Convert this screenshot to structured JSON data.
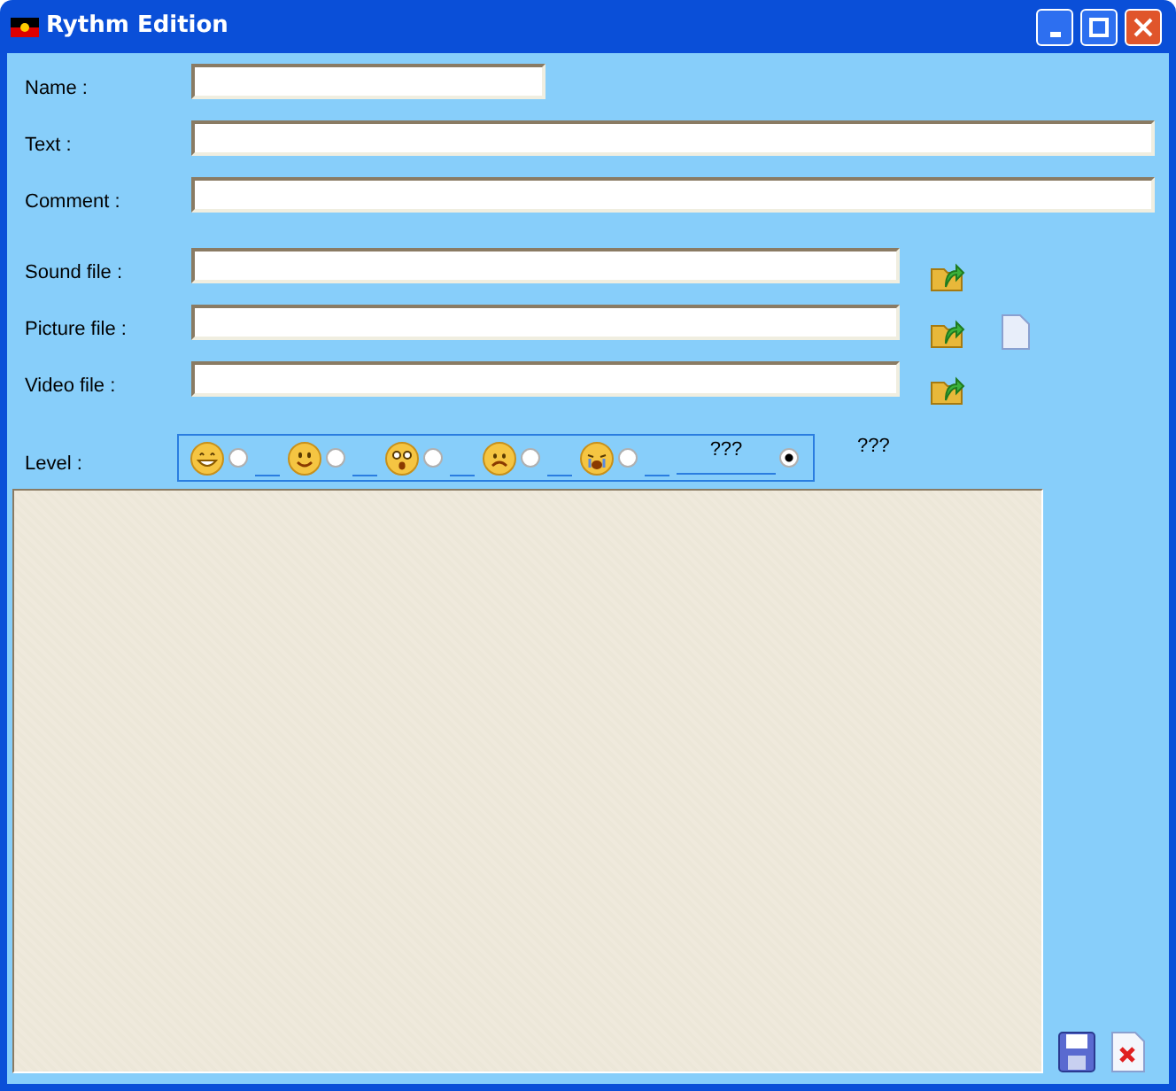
{
  "window": {
    "title": "Rythm Edition"
  },
  "fields": [
    {
      "label": "Name :",
      "full_width": false
    },
    {
      "label": "Text :",
      "full_width": true
    },
    {
      "label": "Comment :",
      "full_width": true
    }
  ],
  "files": [
    {
      "label": "Sound file :",
      "preview": false
    },
    {
      "label": "Picture file :",
      "preview": true
    },
    {
      "label": "Video file :",
      "preview": false
    }
  ],
  "level": {
    "label": "Level :",
    "options": [
      {
        "kind": "laughing",
        "selected": false
      },
      {
        "kind": "smiling",
        "selected": false
      },
      {
        "kind": "surprised",
        "selected": false
      },
      {
        "kind": "sad",
        "selected": false
      },
      {
        "kind": "crying",
        "selected": false
      },
      {
        "kind": "text",
        "label": "???",
        "selected": true
      }
    ],
    "value": "???"
  }
}
